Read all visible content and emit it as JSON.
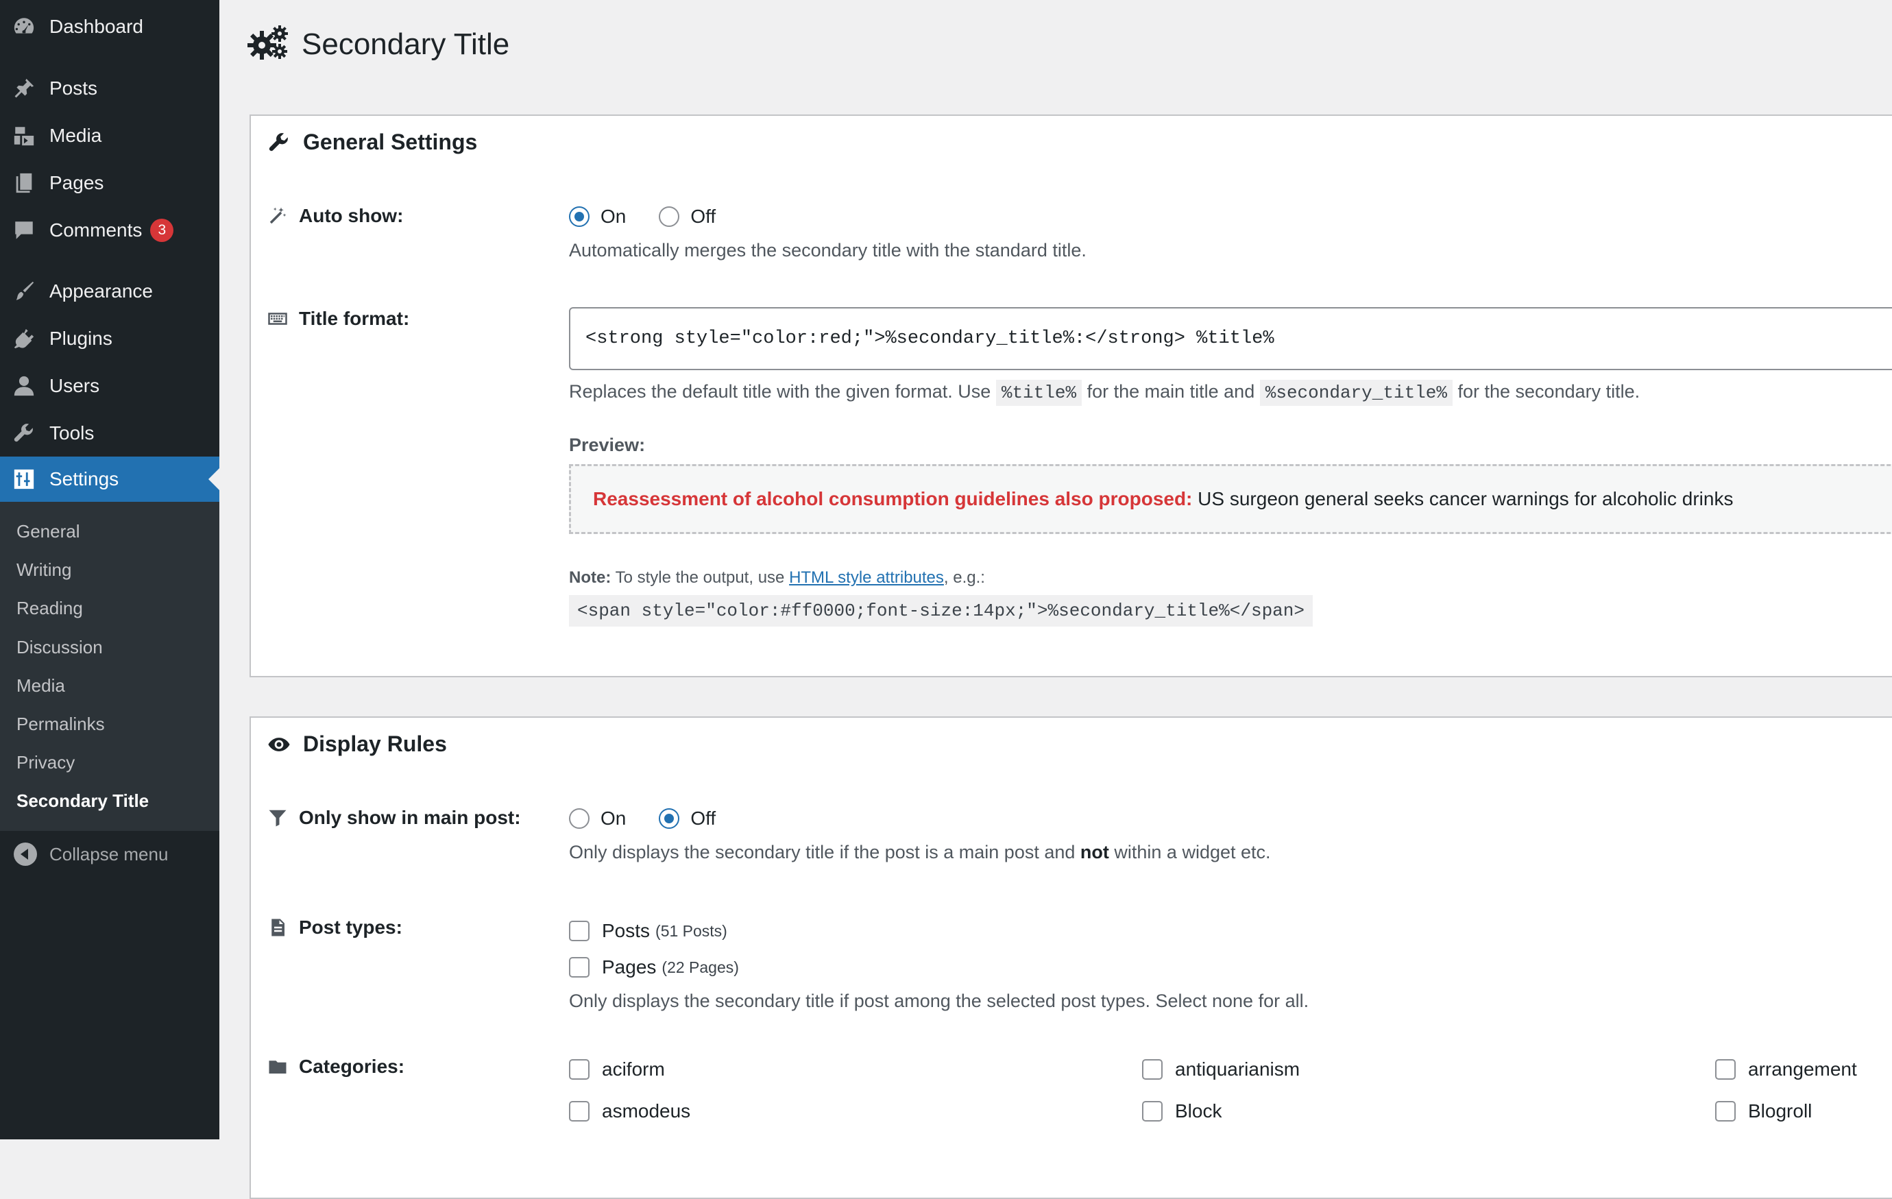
{
  "sidebar": {
    "items": [
      {
        "label": "Dashboard",
        "icon": "dashboard-icon"
      },
      {
        "label": "Posts",
        "icon": "pin-icon"
      },
      {
        "label": "Media",
        "icon": "media-icon"
      },
      {
        "label": "Pages",
        "icon": "pages-icon"
      },
      {
        "label": "Comments",
        "icon": "comment-icon",
        "badge": "3"
      },
      {
        "label": "Appearance",
        "icon": "brush-icon"
      },
      {
        "label": "Plugins",
        "icon": "plugin-icon"
      },
      {
        "label": "Users",
        "icon": "user-icon"
      },
      {
        "label": "Tools",
        "icon": "wrench-icon"
      },
      {
        "label": "Settings",
        "icon": "settings-icon",
        "current": true
      }
    ],
    "submenu": [
      "General",
      "Writing",
      "Reading",
      "Discussion",
      "Media",
      "Permalinks",
      "Privacy",
      "Secondary Title"
    ],
    "submenu_active": "Secondary Title",
    "collapse_label": "Collapse menu"
  },
  "page": {
    "title": "Secondary Title"
  },
  "general": {
    "heading": "General Settings",
    "auto_show": {
      "label": "Auto show:",
      "on_label": "On",
      "off_label": "Off",
      "selected": "On",
      "description": "Automatically merges the secondary title with the standard title."
    },
    "title_format": {
      "label": "Title format:",
      "value": "<strong style=\"color:red;\">%secondary_title%:</strong> %title%",
      "desc_before": "Replaces the default title with the given format. Use",
      "code_title": "%title%",
      "desc_middle": "for the main title and",
      "code_secondary": "%secondary_title%",
      "desc_after": "for the secondary title."
    },
    "preview": {
      "label": "Preview:",
      "secondary": "Reassessment of alcohol consumption guidelines also proposed:",
      "main": "US surgeon general seeks cancer warnings for alcoholic drinks"
    },
    "note": {
      "prefix": "Note:",
      "text_before": "To style the output, use",
      "link": "HTML style attributes",
      "text_after": ", e.g.:",
      "code": "<span style=\"color:#ff0000;font-size:14px;\">%secondary_title%</span>"
    }
  },
  "display": {
    "heading": "Display Rules",
    "only_main": {
      "label": "Only show in main post:",
      "on_label": "On",
      "off_label": "Off",
      "selected": "Off",
      "desc_before": "Only displays the secondary title if the post is a main post and",
      "desc_bold": "not",
      "desc_after": "within a widget etc."
    },
    "post_types": {
      "label": "Post types:",
      "items": [
        {
          "label": "Posts",
          "count": "(51 Posts)",
          "checked": false
        },
        {
          "label": "Pages",
          "count": "(22 Pages)",
          "checked": false
        }
      ],
      "description": "Only displays the secondary title if post among the selected post types. Select none for all."
    },
    "categories": {
      "label": "Categories:",
      "items": [
        "aciform",
        "antiquarianism",
        "arrangement",
        "asmodeus",
        "Block",
        "Blogroll"
      ]
    }
  },
  "colors": {
    "sidebar_bg": "#1d2327",
    "accent": "#2271b1",
    "badge": "#d63638",
    "preview_secondary": "#d63638"
  }
}
